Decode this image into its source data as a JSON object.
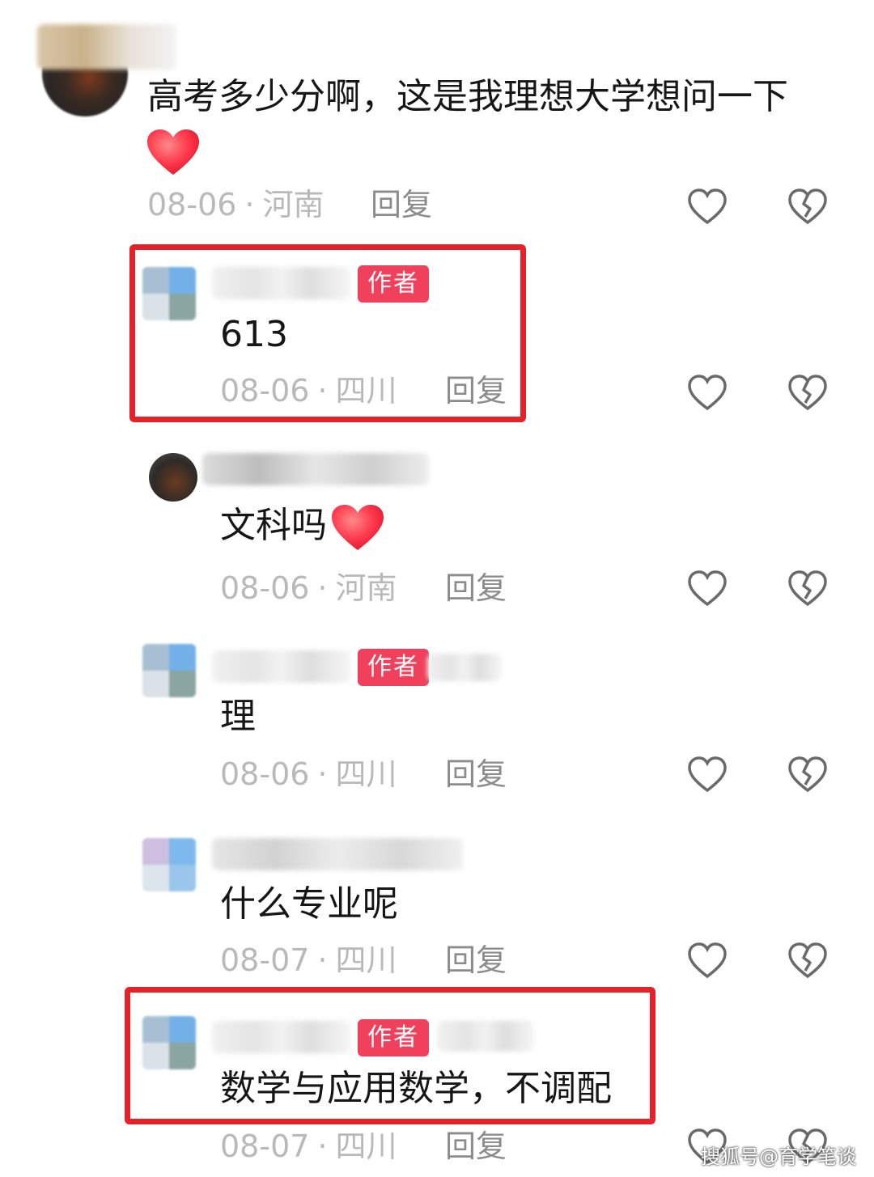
{
  "comments": [
    {
      "text": "高考多少分啊，这是我理想大学想问一下",
      "date": "08-06",
      "location": "河南",
      "reply_label": "回复"
    },
    {
      "badge": "作者",
      "text": "613",
      "date": "08-06",
      "location": "四川",
      "reply_label": "回复"
    },
    {
      "text": "文科吗",
      "date": "08-06",
      "location": "河南",
      "reply_label": "回复"
    },
    {
      "badge": "作者",
      "text": "理",
      "date": "08-06",
      "location": "四川",
      "reply_label": "回复"
    },
    {
      "text": "什么专业呢",
      "date": "08-07",
      "location": "四川",
      "reply_label": "回复"
    },
    {
      "badge": "作者",
      "text": "数学与应用数学，不调配",
      "date": "08-07",
      "location": "四川",
      "reply_label": "回复"
    }
  ],
  "meta_separator": "·",
  "icons": {
    "like": "heart-outline-icon",
    "dislike": "broken-heart-icon",
    "emoji": "red-heart-emoji"
  },
  "colors": {
    "badge": "#f0405c",
    "highlight": "#e5212a",
    "meta": "#b9b9b9",
    "heart": "#ff3b4e"
  },
  "watermark": "搜狐号@育学笔谈"
}
